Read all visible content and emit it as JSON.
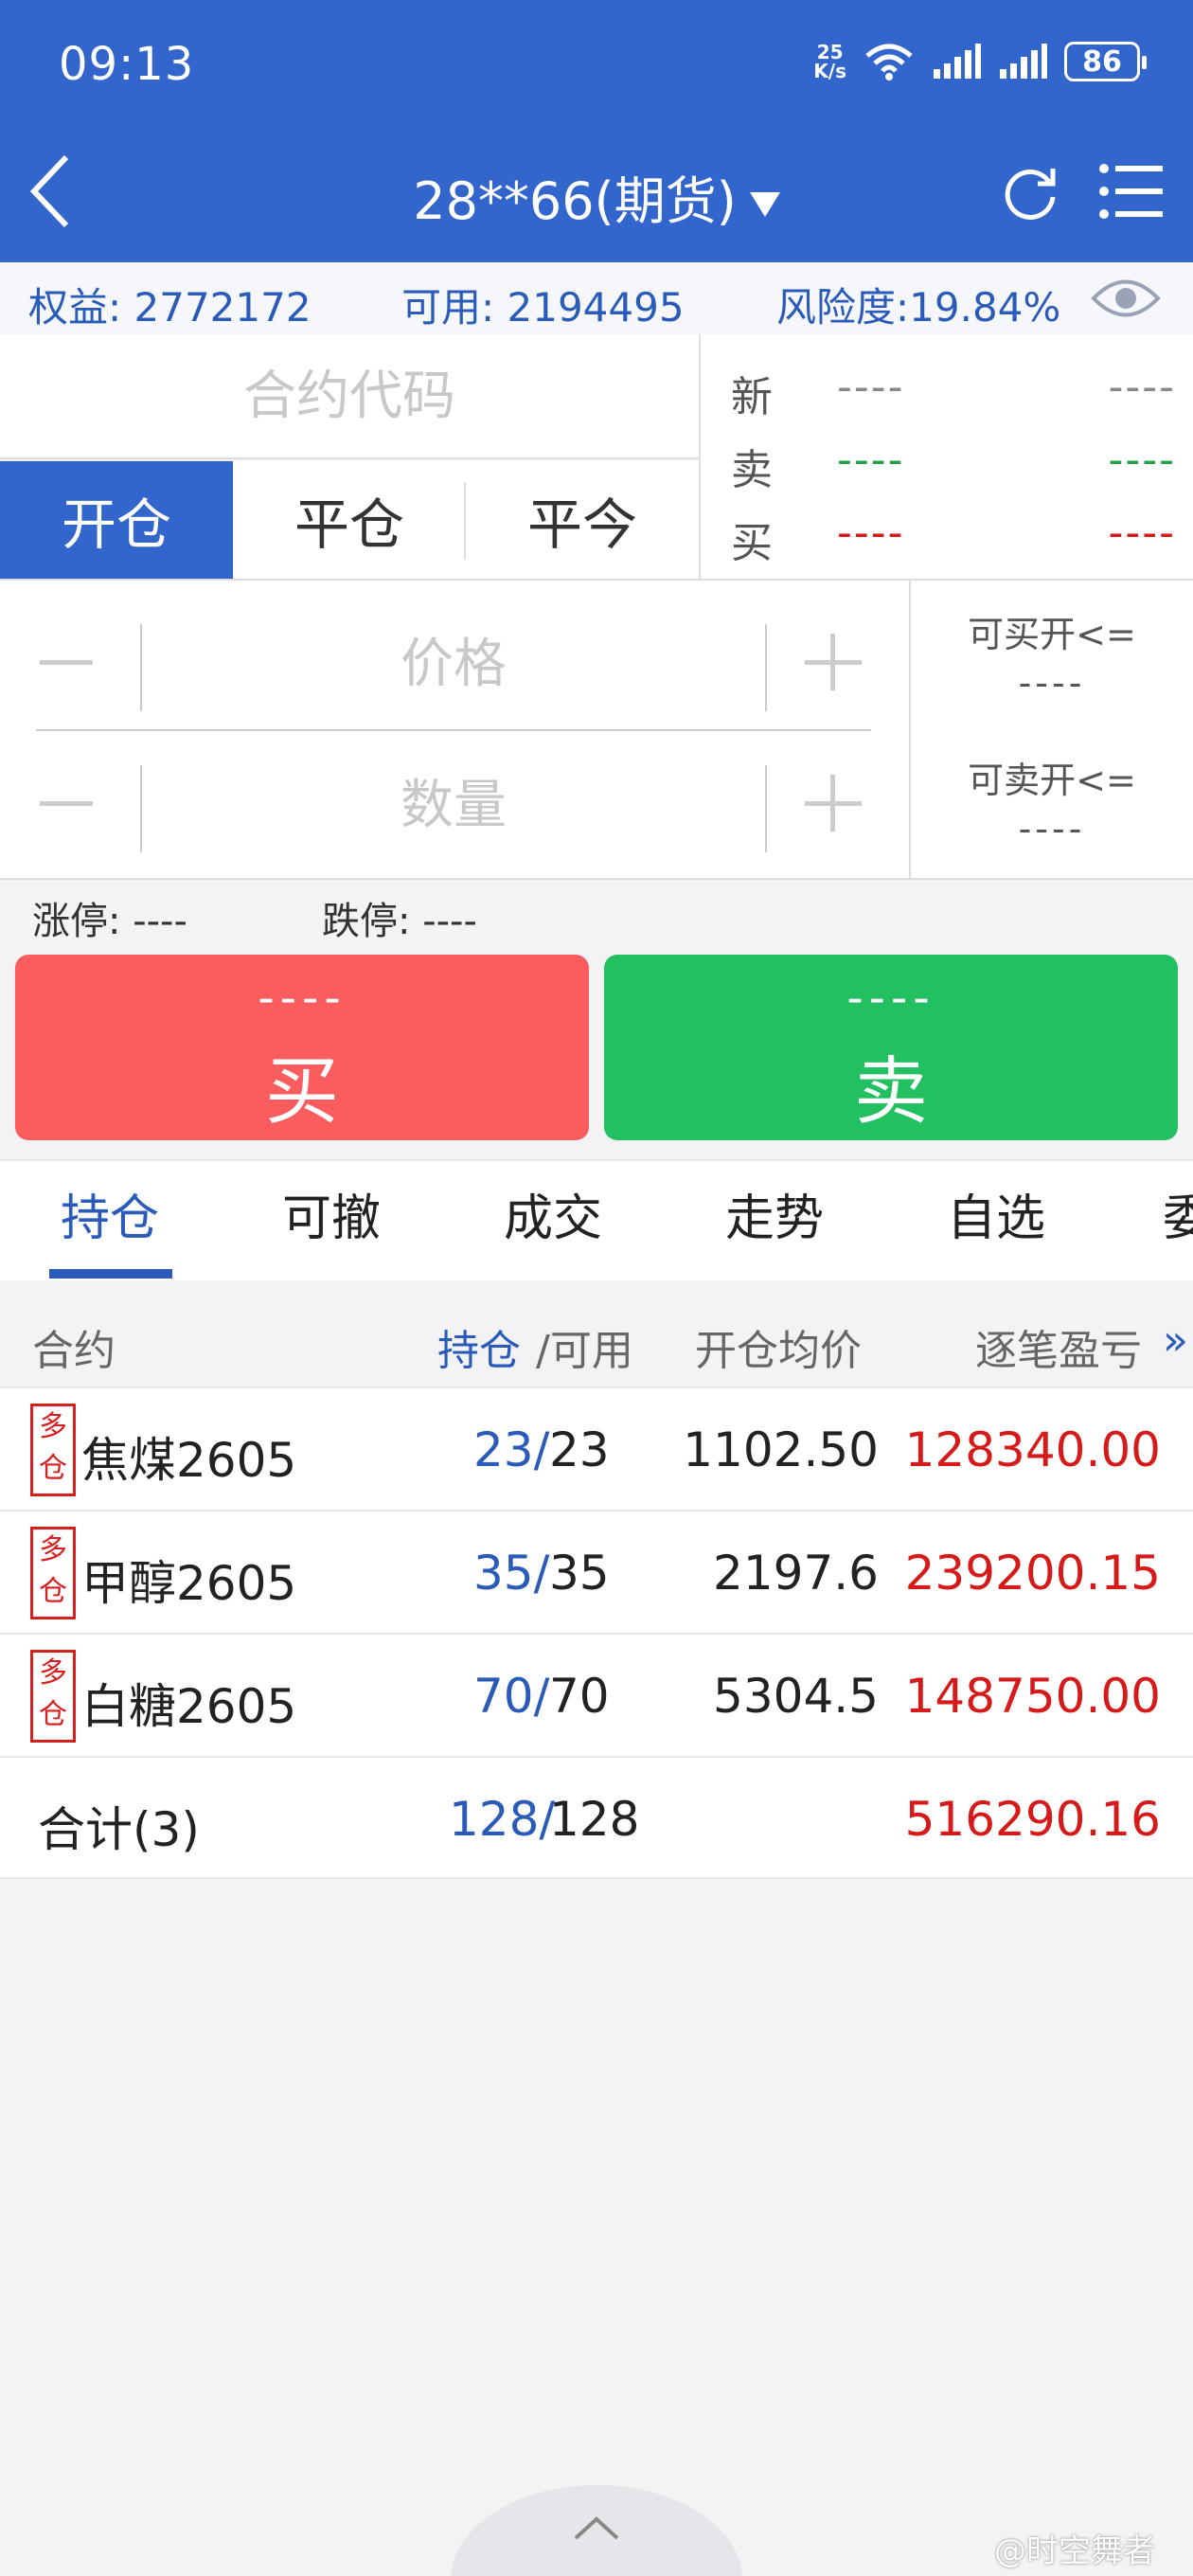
{
  "status_bar": {
    "time": "09:13",
    "net_speed_top": "25",
    "net_speed_bottom": "K/s",
    "battery": "86"
  },
  "header": {
    "title": "28**66(期货)"
  },
  "account": {
    "equity": "权益: 2772172",
    "available": "可用: 2194495",
    "risk": "风险度:19.84%"
  },
  "order": {
    "code_placeholder": "合约代码",
    "tabs": [
      "开仓",
      "平仓",
      "平今"
    ],
    "quote": [
      {
        "label": "新",
        "v1": "----",
        "v2": "----",
        "color": "#888888"
      },
      {
        "label": "卖",
        "v1": "----",
        "v2": "----",
        "color": "#22a04a"
      },
      {
        "label": "买",
        "v1": "----",
        "v2": "----",
        "color": "#d61a1a"
      }
    ],
    "price_placeholder": "价格",
    "qty_placeholder": "数量",
    "can_buy_label": "可买开<=",
    "can_buy_value": "----",
    "can_sell_label": "可卖开<=",
    "can_sell_value": "----",
    "limit_up": "涨停: ----",
    "limit_down": "跌停: ----",
    "buy": {
      "price": "----",
      "label": "买"
    },
    "sell": {
      "price": "----",
      "label": "卖"
    }
  },
  "bottom_tabs": [
    "持仓",
    "可撤",
    "成交",
    "走势",
    "自选",
    "委"
  ],
  "positions": {
    "headers": {
      "contract": "合约",
      "hold": "持仓",
      "avail": "/可用",
      "avg": "开仓均价",
      "pnl": "逐笔盈亏"
    },
    "rows": [
      {
        "tag1": "多",
        "tag2": "仓",
        "name": "焦煤2605",
        "hold": "23/",
        "avail": "23",
        "avg": "1102.50",
        "pnl": "128340.00"
      },
      {
        "tag1": "多",
        "tag2": "仓",
        "name": "甲醇2605",
        "hold": "35/",
        "avail": "35",
        "avg": "2197.6",
        "pnl": "239200.15"
      },
      {
        "tag1": "多",
        "tag2": "仓",
        "name": "白糖2605",
        "hold": "70/",
        "avail": "70",
        "avg": "5304.5",
        "pnl": "148750.00"
      }
    ],
    "total": {
      "label": "合计(3)",
      "hold": "128/",
      "avail": "128",
      "pnl": "516290.16"
    }
  },
  "watermark": "@时空舞者"
}
